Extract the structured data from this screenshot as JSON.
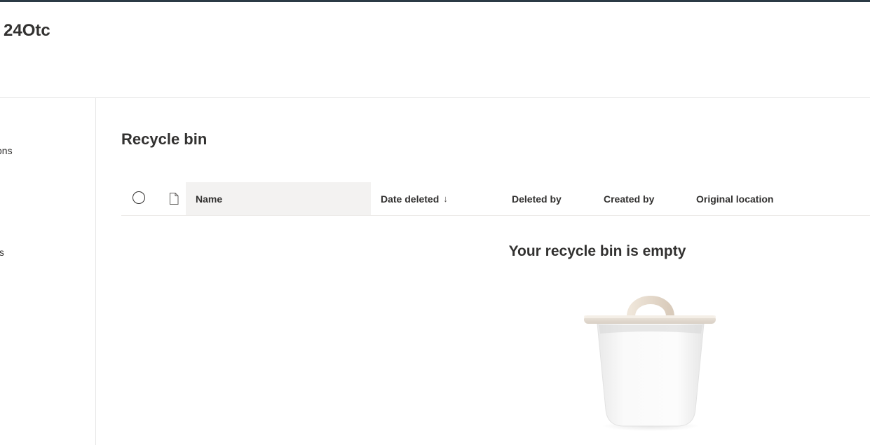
{
  "site": {
    "title": "24Otc"
  },
  "nav": {
    "items": [
      {
        "label": "ons"
      },
      {
        "label": "ts"
      }
    ]
  },
  "page": {
    "title": "Recycle bin"
  },
  "list": {
    "columns": {
      "name": "Name",
      "date_deleted": "Date deleted",
      "date_deleted_sort": "↓",
      "deleted_by": "Deleted by",
      "created_by": "Created by",
      "original_location": "Original location"
    },
    "rows": []
  },
  "empty_state": {
    "message": "Your recycle bin is empty"
  },
  "colors": {
    "topbar": "#2b3a45",
    "text": "#323130",
    "header_selected_bg": "#f3f2f1",
    "divider": "#e6e6e6"
  },
  "icons": {
    "select_all": "circle-checkbox-icon",
    "file_type": "document-icon",
    "empty": "recycle-bin-illustration"
  }
}
